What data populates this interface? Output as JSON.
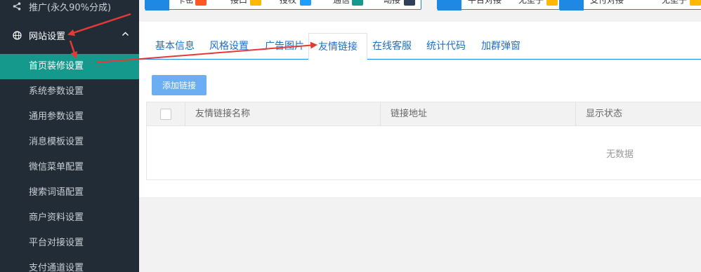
{
  "sidebar": {
    "promo_label": "推广(永久90%分成)",
    "group_label": "网站设置",
    "items": [
      {
        "label": "首页装修设置",
        "active": true
      },
      {
        "label": "系统参数设置",
        "active": false
      },
      {
        "label": "通用参数设置",
        "active": false
      },
      {
        "label": "消息模板设置",
        "active": false
      },
      {
        "label": "微信菜单配置",
        "active": false
      },
      {
        "label": "搜索词语配置",
        "active": false
      },
      {
        "label": "商户资料设置",
        "active": false
      },
      {
        "label": "平台对接设置",
        "active": false
      },
      {
        "label": "支付通道设置",
        "active": false
      }
    ],
    "colors": {
      "background": "#222c36",
      "active": "#16998d"
    }
  },
  "topstrip": {
    "fragments": [
      "卡密",
      "接口",
      "授权",
      "通信",
      "动接",
      "平台对接",
      "无垫子",
      "支付对接",
      "无垫子"
    ],
    "badge_colors": [
      "#ff5722",
      "#ffb800",
      "#1e9fff",
      "#16998d",
      "#2f4056",
      "#ffb800",
      "#ffb800"
    ]
  },
  "tabs": [
    {
      "label": "基本信息"
    },
    {
      "label": "风格设置"
    },
    {
      "label": "广告图片"
    },
    {
      "label": "友情链接",
      "active": true
    },
    {
      "label": "在线客服"
    },
    {
      "label": "统计代码"
    },
    {
      "label": "加群弹窗"
    }
  ],
  "toolbar": {
    "add_label": "添加链接"
  },
  "table": {
    "columns": [
      "友情链接名称",
      "链接地址",
      "显示状态"
    ],
    "rows": [],
    "empty_text": "无数据"
  },
  "colors": {
    "accent": "#1e88e5",
    "button": "#6caef2",
    "arrow": "#e53935"
  }
}
